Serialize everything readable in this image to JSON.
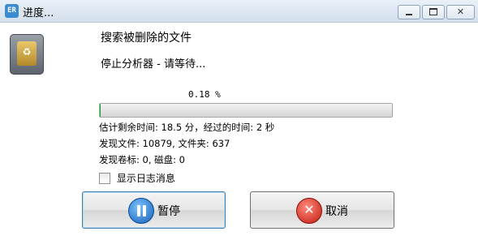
{
  "window": {
    "app_icon_text": "ER",
    "title": "进度..."
  },
  "dialog": {
    "heading": "搜索被删除的文件",
    "status": "停止分析器 - 请等待...",
    "progress": {
      "percent_text": "0.18 %",
      "value_fraction": 0.0018
    },
    "info": {
      "time_line": "估计剩余时间: 18.5 分，经过的时间: 2 秒",
      "found_line": "发现文件: 10879, 文件夹: 637",
      "volume_line": "发现卷标: 0, 磁盘: 0"
    },
    "checkbox": {
      "label": "显示日志消息",
      "checked": false
    },
    "buttons": {
      "pause_label": "暂停",
      "cancel_label": "取消"
    }
  },
  "colors": {
    "progress_fill": "#06b025",
    "pause_icon": "#1560b5",
    "cancel_icon": "#c01a10"
  },
  "icons": {
    "app": "app-logo-icon",
    "recycle": "recycle-bin-icon",
    "pause": "pause-icon",
    "cancel": "cancel-x-icon",
    "minimize": "minimize-icon",
    "maximize": "maximize-icon",
    "close": "close-icon"
  }
}
